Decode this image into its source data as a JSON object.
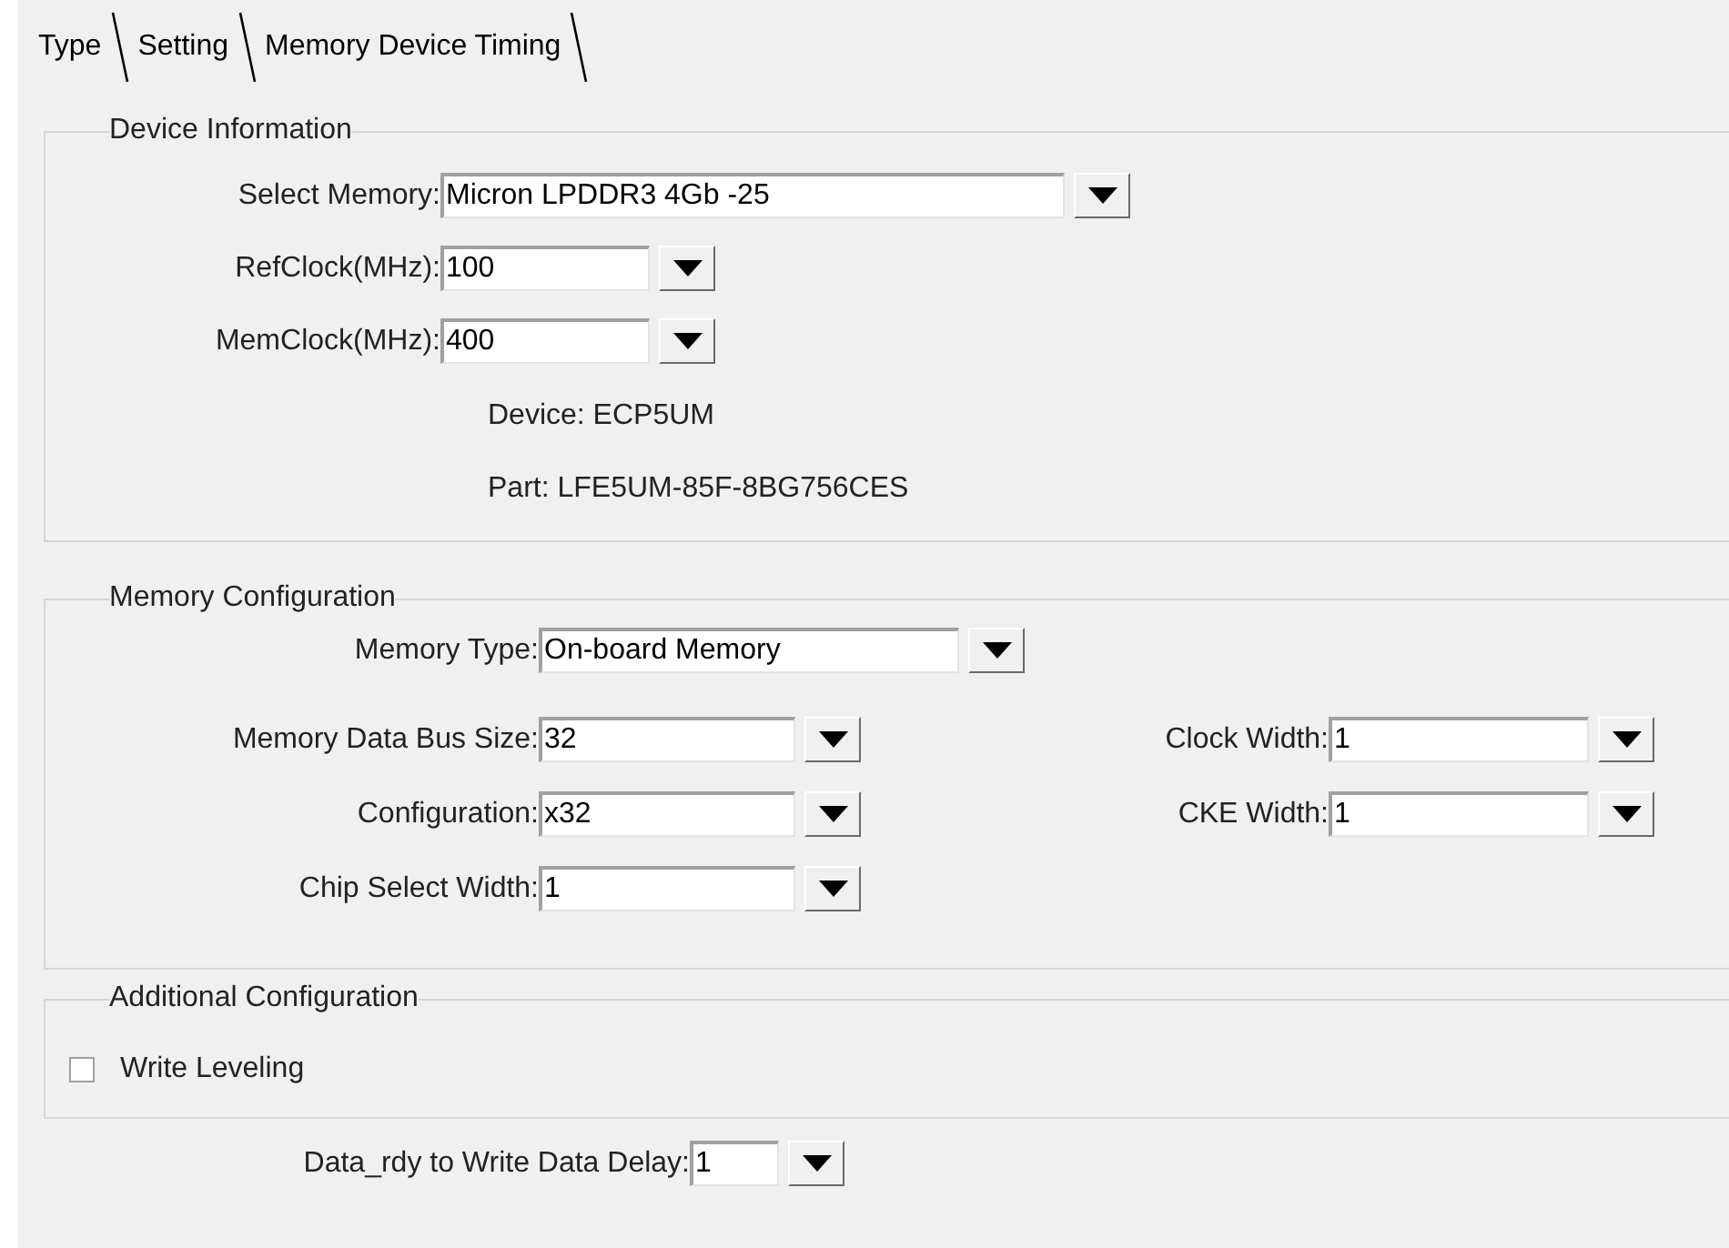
{
  "tabs": [
    {
      "label": "Type"
    },
    {
      "label": "Setting"
    },
    {
      "label": "Memory Device Timing"
    }
  ],
  "device_information": {
    "title": "Device Information",
    "fields": [
      {
        "label": "Select Memory:",
        "value": "Micron LPDDR3 4Gb -25"
      },
      {
        "label": "RefClock(MHz):",
        "value": "100"
      },
      {
        "label": "MemClock(MHz):",
        "value": "400"
      }
    ],
    "info": [
      "Device: ECP5UM",
      "Part: LFE5UM-85F-8BG756CES"
    ]
  },
  "memory_configuration": {
    "title": "Memory Configuration",
    "memory_type": {
      "label": "Memory Type:",
      "value": "On-board Memory"
    },
    "left": [
      {
        "label": "Memory Data Bus Size:",
        "value": "32"
      },
      {
        "label": "Configuration:",
        "value": "x32"
      },
      {
        "label": "Chip Select Width:",
        "value": "1"
      }
    ],
    "right": [
      {
        "label": "Clock Width:",
        "value": "1"
      },
      {
        "label": "CKE Width:",
        "value": "1"
      }
    ]
  },
  "additional_configuration": {
    "title": "Additional Configuration",
    "options": [
      {
        "label": "Write Leveling",
        "checked": false
      }
    ]
  },
  "data_delay": {
    "label": "Data_rdy to Write Data Delay:",
    "value": "1"
  }
}
